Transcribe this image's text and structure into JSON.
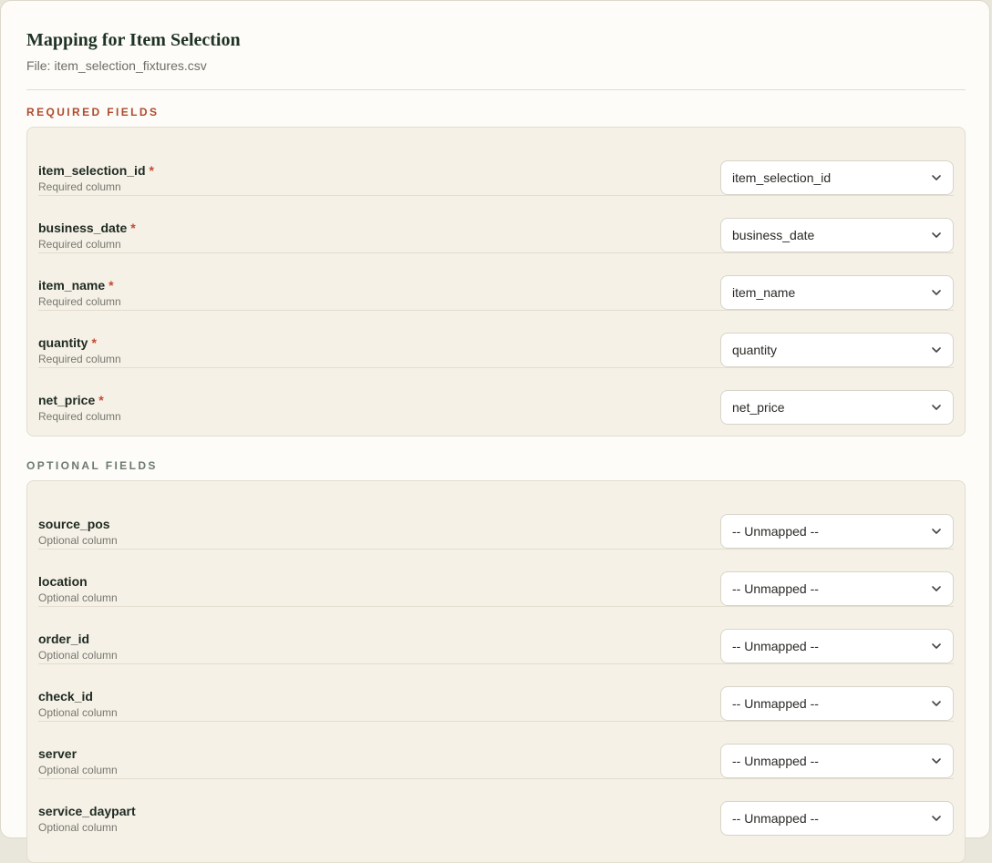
{
  "header": {
    "title": "Mapping for Item Selection",
    "file_label": "File:",
    "file_name": "item_selection_fixtures.csv"
  },
  "sections": {
    "required": {
      "heading": "REQUIRED FIELDS",
      "fields": [
        {
          "name": "item_selection_id",
          "marker": "*",
          "description": "Required column",
          "value": "item_selection_id"
        },
        {
          "name": "business_date",
          "marker": "*",
          "description": "Required column",
          "value": "business_date"
        },
        {
          "name": "item_name",
          "marker": "*",
          "description": "Required column",
          "value": "item_name"
        },
        {
          "name": "quantity",
          "marker": "*",
          "description": "Required column",
          "value": "quantity"
        },
        {
          "name": "net_price",
          "marker": "*",
          "description": "Required column",
          "value": "net_price"
        }
      ]
    },
    "optional": {
      "heading": "OPTIONAL FIELDS",
      "fields": [
        {
          "name": "source_pos",
          "description": "Optional column",
          "value": "-- Unmapped --"
        },
        {
          "name": "location",
          "description": "Optional column",
          "value": "-- Unmapped --"
        },
        {
          "name": "order_id",
          "description": "Optional column",
          "value": "-- Unmapped --"
        },
        {
          "name": "check_id",
          "description": "Optional column",
          "value": "-- Unmapped --"
        },
        {
          "name": "server",
          "description": "Optional column",
          "value": "-- Unmapped --"
        },
        {
          "name": "service_daypart",
          "description": "Optional column",
          "value": "-- Unmapped --"
        }
      ]
    }
  },
  "icons": {
    "select_chevron": "chevron-down-icon"
  },
  "colors": {
    "required_accent": "#b04a2e",
    "asterisk": "#c44a32",
    "optional_heading": "#6c7a6f",
    "title": "#1f3324",
    "panel_bg": "#f5f1e6",
    "page_bg": "#fdfcf8"
  }
}
